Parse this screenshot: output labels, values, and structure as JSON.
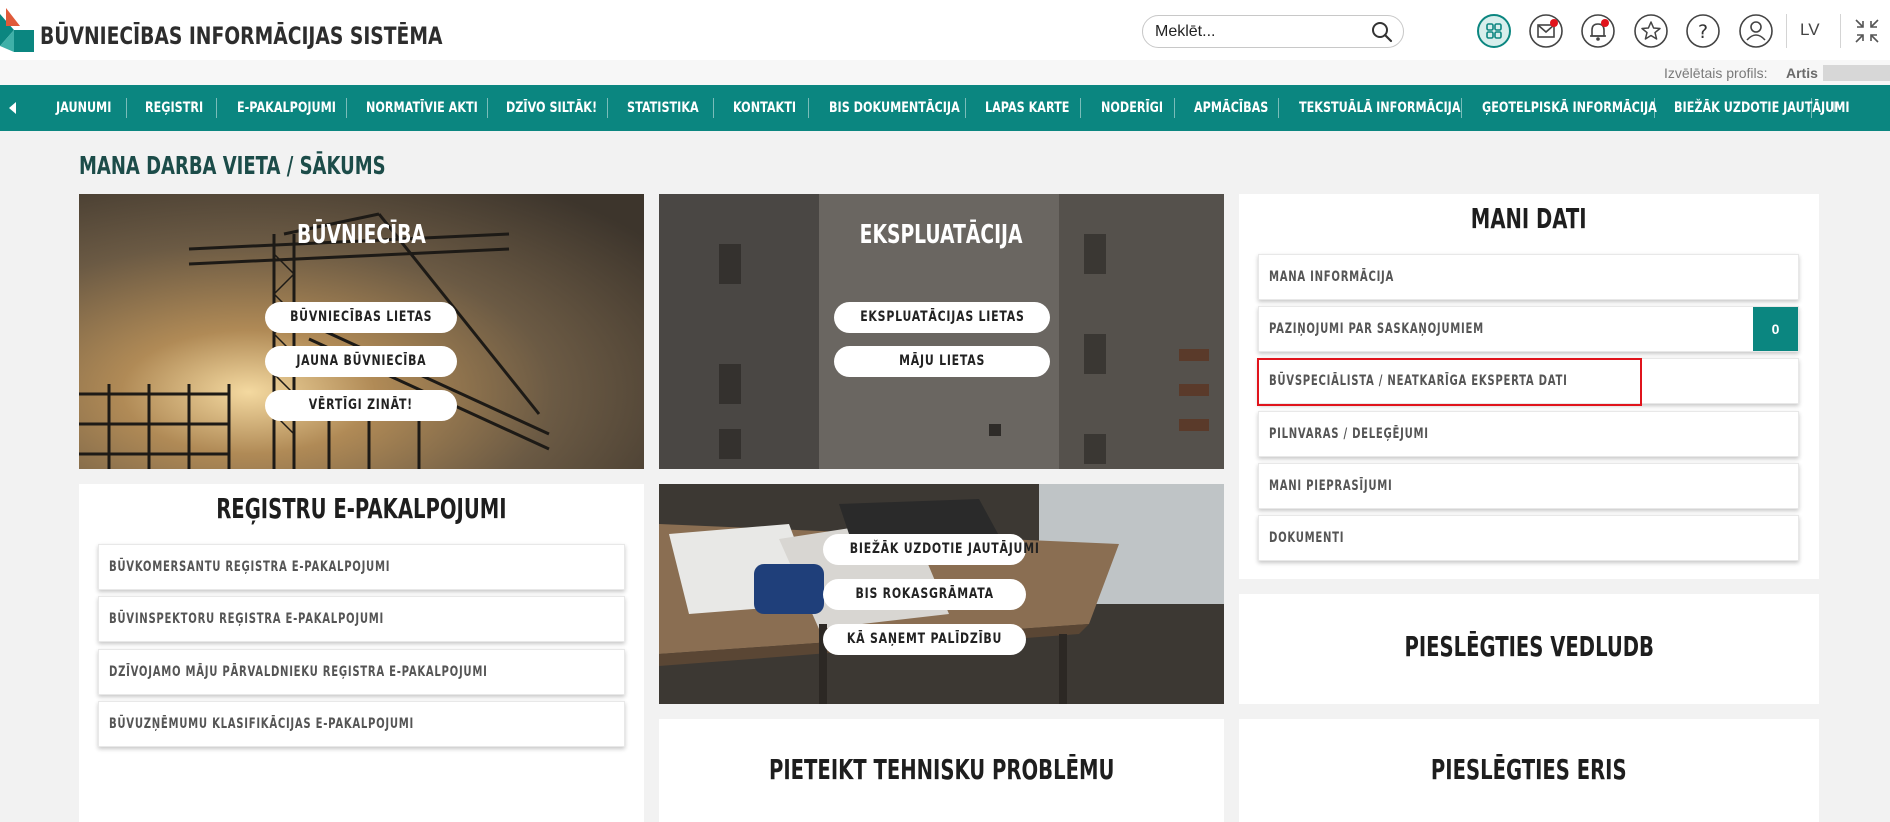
{
  "header": {
    "logo_text": "BŪVNIECĪBAS INFORMĀCIJAS SISTĒMA",
    "search_placeholder": "Meklēt...",
    "language": "LV",
    "icons": [
      "apps-grid-icon",
      "mail-icon",
      "bell-icon",
      "star-icon",
      "help-icon",
      "user-icon",
      "collapse-icon"
    ],
    "profile_label": "Izvēlētais profils:",
    "profile_name": "Artis"
  },
  "colors": {
    "accent": "#0b8680",
    "title": "#1c4c49",
    "highlight": "#e0141c"
  },
  "nav": {
    "items": [
      "JAUNUMI",
      "REĢISTRI",
      "E-PAKALPOJUMI",
      "NORMATĪVIE AKTI",
      "DZĪVO SILTĀK!",
      "STATISTIKA",
      "KONTAKTI",
      "BIS DOKUMENTĀCIJA",
      "LAPAS KARTE",
      "NODERĪGI",
      "APMĀCĪBAS",
      "TEKSTUĀLĀ INFORMĀCIJA",
      "ĢEOTELPISKĀ INFORMĀCIJA",
      "BIEŽĀK UZDOTIE JAUTĀJUMI",
      "F"
    ]
  },
  "page_title": "MANA DARBA VIETA / SĀKUMS",
  "buvnieciba": {
    "title": "BŪVNIECĪBA",
    "buttons": [
      "BŪVNIECĪBAS LIETAS",
      "JAUNA BŪVNIECĪBA",
      "VĒRTĪGI ZINĀT!"
    ]
  },
  "ekspluatacija": {
    "title": "EKSPLUATĀCIJA",
    "buttons": [
      "EKSPLUATĀCIJAS LIETAS",
      "MĀJU LIETAS"
    ]
  },
  "help_tile": {
    "buttons": [
      "BIEŽĀK UZDOTIE JAUTĀJUMI",
      "BIS ROKASGRĀMATA",
      "KĀ SAŅEMT PALĪDZĪBU"
    ]
  },
  "registri": {
    "title": "REĢISTRU E-PAKALPOJUMI",
    "items": [
      "BŪVKOMERSANTU REĢISTRA E-PAKALPOJUMI",
      "BŪVINSPEKTORU REĢISTRA E-PAKALPOJUMI",
      "DZĪVOJAMO MĀJU PĀRVALDNIEKU REĢISTRA E-PAKALPOJUMI",
      "BŪVUZŅĒMUMU KLASIFIKĀCIJAS E-PAKALPOJUMI"
    ]
  },
  "mani_dati": {
    "title": "MANI DATI",
    "items": [
      "MANA INFORMĀCIJA",
      "PAZIŅOJUMI PAR SASKAŅOJUMIEM",
      "BŪVSPECIĀLISTA / NEATKARĪGA EKSPERTA DATI",
      "PILNVARAS / DELEĢĒJUMI",
      "MANI PIEPRASĪJUMI",
      "DOKUMENTI"
    ],
    "notifications_count": "0"
  },
  "vedludb": {
    "title": "PIESLĒGTIES VEDLUDB"
  },
  "tech_problem": {
    "title": "PIETEIKT TEHNISKU PROBLĒMU"
  },
  "eris": {
    "title": "PIESLĒGTIES ERIS"
  }
}
